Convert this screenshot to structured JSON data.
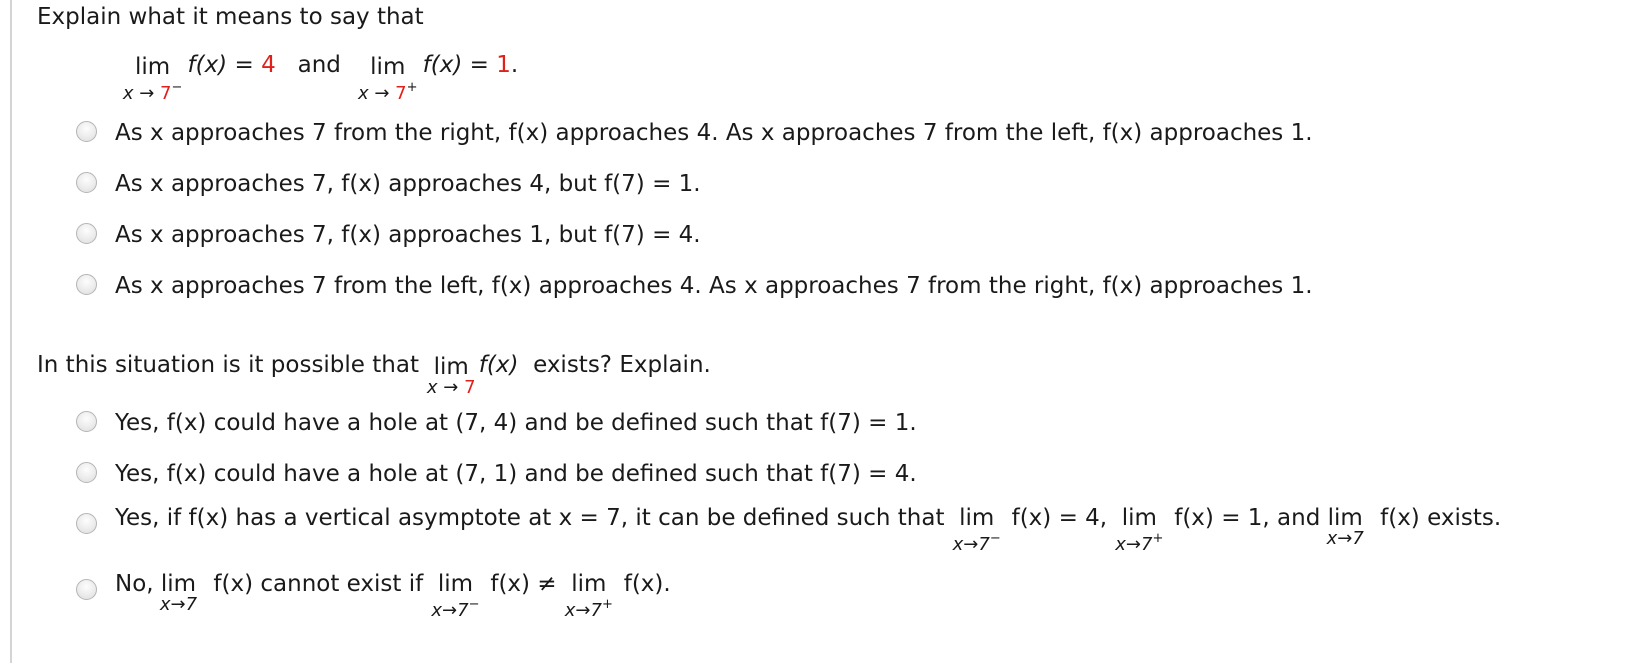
{
  "q1": {
    "prompt": "Explain what it means to say that",
    "display": {
      "lim1": "lim",
      "sub1_var": "x → ",
      "sub1_val": "7",
      "sub1_sup": "−",
      "fx1": "f(x)",
      "eq1": " = ",
      "val1": "4",
      "and": "and",
      "lim2": "lim",
      "sub2_var": "x → ",
      "sub2_val": "7",
      "sub2_sup": "+",
      "fx2": "f(x)",
      "eq2": " = ",
      "val2": "1",
      "period": "."
    },
    "accent_color": "#e0201b",
    "options": [
      {
        "text": "As x approaches 7 from the right, f(x) approaches 4. As x approaches 7 from the left, f(x) approaches 1.",
        "selected": false
      },
      {
        "text": "As x approaches 7, f(x) approaches 4, but f(7) = 1.",
        "selected": false
      },
      {
        "text": "As x approaches 7, f(x) approaches 1, but f(7) = 4.",
        "selected": false
      },
      {
        "text": "As x approaches 7 from the left, f(x) approaches 4. As x approaches 7 from the right, f(x) approaches 1.",
        "selected": false
      }
    ]
  },
  "q2": {
    "prompt_before": "In this situation is it possible that",
    "lim": "lim",
    "sub_var": "x → ",
    "sub_val": "7",
    "fx": "f(x)",
    "prompt_after": "exists? Explain.",
    "options": [
      {
        "text": "Yes, f(x) could have a hole at (7, 4) and be defined such that f(7) = 1.",
        "selected": false
      },
      {
        "text": "Yes, f(x) could have a hole at (7, 1) and be defined such that f(7) = 4.",
        "selected": false
      },
      {
        "text_before": "Yes, if f(x) has a vertical asymptote at x = 7, it can be defined such that",
        "lim": "lim",
        "sub_a": "x→7",
        "sup_a": "−",
        "eq_a": "f(x) = 4,",
        "sub_b": "x→7",
        "sup_b": "+",
        "eq_b": "f(x) = 1, and",
        "sub_c": "x→7",
        "eq_c": "f(x) exists.",
        "selected": false
      },
      {
        "text_before": "No,",
        "lim": "lim",
        "sub_a": "x→7",
        "mid_a": "f(x) cannot exist if",
        "sub_b": "x→7",
        "sup_b": "−",
        "mid_b": "f(x) ≠",
        "sub_c": "x→7",
        "sup_c": "+",
        "end": "f(x).",
        "selected": false
      }
    ]
  }
}
